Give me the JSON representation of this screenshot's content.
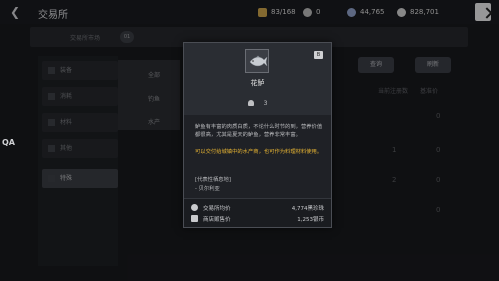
{
  "header": {
    "title": "交易所",
    "stats": [
      {
        "icon": "bag-capacity-icon",
        "value": "83/168",
        "color": "#c9a24a"
      },
      {
        "icon": "silver-coin-icon",
        "value": "0",
        "color": "#b8b8b8"
      },
      {
        "icon": "energy-icon",
        "value": "44,765",
        "color": "#8fa0c8"
      },
      {
        "icon": "silver-icon",
        "value": "828,701",
        "color": "#d0d0d0"
      }
    ]
  },
  "background": {
    "tabs": [
      "交易所市场",
      "",
      "",
      ""
    ],
    "tab_badge": "01",
    "sidebar": [
      "装备",
      "消耗",
      "材料",
      "其他",
      "特殊"
    ],
    "subcol": [
      "全部",
      "钓鱼",
      "水产"
    ],
    "right_buttons": [
      "查询",
      "刷新"
    ],
    "right_headers": [
      "当前注册数",
      "基准价"
    ],
    "right_values": [
      "0",
      "0",
      "1",
      "0",
      "2",
      "0"
    ]
  },
  "qa_label": "QA",
  "popup": {
    "item_name": "花鲈",
    "close_tag": "B",
    "weight": "3",
    "description": "鲈鱼有丰富的肉质白质，不论什么时节的到，营养价值都很高，尤其是夏天的鲈鱼，营养非常丰富。",
    "highlight": "可以交付给城镇中的水产商，也可作为料理材料使用。",
    "origin_title": "[代表性栖息地]",
    "origin_item": "- 贝尔利亚",
    "prices": [
      {
        "icon": "scale-icon",
        "label": "交易所均价",
        "value": "4,774黑珍珠"
      },
      {
        "icon": "shop-icon",
        "label": "商店贩售价",
        "value": "1,253银币"
      }
    ]
  }
}
